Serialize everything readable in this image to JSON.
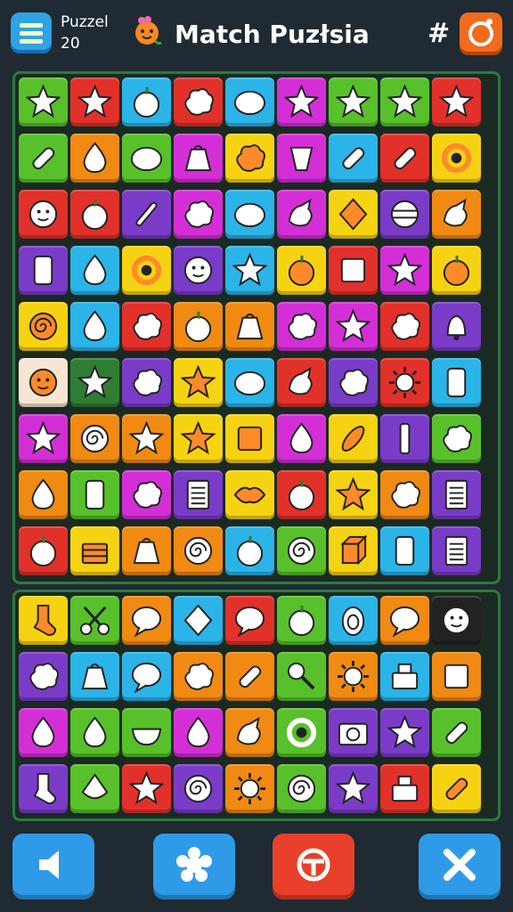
{
  "header": {
    "level_label": "Puzzel",
    "level_number": "20",
    "title": "Match Puzłsia",
    "hash_label": "#",
    "icons": [
      "menu-icon",
      "mascot-icon",
      "settings-icon"
    ]
  },
  "colors": {
    "bg": "#1f2a33",
    "board_border": "#2c7a3e",
    "G": "#58c02a",
    "R": "#e2312a",
    "B": "#2bb4e8",
    "O": "#f08a12",
    "Y": "#f6d312",
    "M": "#d42fd6",
    "P": "#7a3cc8",
    "W": "#f6e6d2",
    "DG": "#2e7d33",
    "DK": "#222222"
  },
  "board_top": {
    "rows": [
      [
        {
          "c": "G",
          "i": "star"
        },
        {
          "c": "R",
          "i": "star"
        },
        {
          "c": "B",
          "i": "apple"
        },
        {
          "c": "R",
          "i": "cloud"
        },
        {
          "c": "B",
          "i": "blob"
        },
        {
          "c": "M",
          "i": "star"
        },
        {
          "c": "G",
          "i": "star"
        },
        {
          "c": "G",
          "i": "star"
        },
        {
          "c": "R",
          "i": "star"
        }
      ],
      [
        {
          "c": "G",
          "i": "pill"
        },
        {
          "c": "O",
          "i": "drop"
        },
        {
          "c": "G",
          "i": "blob"
        },
        {
          "c": "M",
          "i": "bag"
        },
        {
          "c": "Y",
          "i": "cloud"
        },
        {
          "c": "M",
          "i": "cup"
        },
        {
          "c": "B",
          "i": "pill"
        },
        {
          "c": "R",
          "i": "pill"
        },
        {
          "c": "Y",
          "i": "ring"
        }
      ],
      [
        {
          "c": "R",
          "i": "face"
        },
        {
          "c": "R",
          "i": "apple"
        },
        {
          "c": "P",
          "i": "stick"
        },
        {
          "c": "M",
          "i": "cloud"
        },
        {
          "c": "B",
          "i": "blob"
        },
        {
          "c": "M",
          "i": "bird"
        },
        {
          "c": "Y",
          "i": "gem"
        },
        {
          "c": "P",
          "i": "ball"
        },
        {
          "c": "O",
          "i": "bird"
        }
      ],
      [
        {
          "c": "P",
          "i": "phone"
        },
        {
          "c": "B",
          "i": "drop"
        },
        {
          "c": "Y",
          "i": "ring"
        },
        {
          "c": "P",
          "i": "face"
        },
        {
          "c": "B",
          "i": "star"
        },
        {
          "c": "Y",
          "i": "apple"
        },
        {
          "c": "R",
          "i": "box"
        },
        {
          "c": "M",
          "i": "star"
        },
        {
          "c": "Y",
          "i": "apple"
        }
      ],
      [
        {
          "c": "Y",
          "i": "swirl"
        },
        {
          "c": "B",
          "i": "drop"
        },
        {
          "c": "R",
          "i": "cloud"
        },
        {
          "c": "O",
          "i": "apple"
        },
        {
          "c": "O",
          "i": "bag"
        },
        {
          "c": "M",
          "i": "cloud"
        },
        {
          "c": "M",
          "i": "star"
        },
        {
          "c": "R",
          "i": "cloud"
        },
        {
          "c": "P",
          "i": "bell"
        }
      ],
      [
        {
          "c": "W",
          "i": "face"
        },
        {
          "c": "DG",
          "i": "star"
        },
        {
          "c": "P",
          "i": "cloud"
        },
        {
          "c": "Y",
          "i": "star"
        },
        {
          "c": "B",
          "i": "blob"
        },
        {
          "c": "R",
          "i": "bird"
        },
        {
          "c": "P",
          "i": "cloud"
        },
        {
          "c": "R",
          "i": "sun"
        },
        {
          "c": "B",
          "i": "phone"
        }
      ],
      [
        {
          "c": "M",
          "i": "star"
        },
        {
          "c": "O",
          "i": "swirl"
        },
        {
          "c": "O",
          "i": "star"
        },
        {
          "c": "Y",
          "i": "star"
        },
        {
          "c": "Y",
          "i": "box"
        },
        {
          "c": "M",
          "i": "drop"
        },
        {
          "c": "Y",
          "i": "feather"
        },
        {
          "c": "P",
          "i": "bar"
        },
        {
          "c": "G",
          "i": "cloud"
        }
      ],
      [
        {
          "c": "O",
          "i": "drop"
        },
        {
          "c": "G",
          "i": "phone"
        },
        {
          "c": "M",
          "i": "cloud"
        },
        {
          "c": "P",
          "i": "note"
        },
        {
          "c": "Y",
          "i": "lips"
        },
        {
          "c": "R",
          "i": "apple"
        },
        {
          "c": "Y",
          "i": "star"
        },
        {
          "c": "O",
          "i": "cloud"
        },
        {
          "c": "P",
          "i": "note"
        }
      ],
      [
        {
          "c": "R",
          "i": "apple"
        },
        {
          "c": "Y",
          "i": "basket"
        },
        {
          "c": "O",
          "i": "bag"
        },
        {
          "c": "O",
          "i": "swirl"
        },
        {
          "c": "B",
          "i": "apple"
        },
        {
          "c": "G",
          "i": "swirl"
        },
        {
          "c": "Y",
          "i": "cube"
        },
        {
          "c": "B",
          "i": "phone"
        },
        {
          "c": "P",
          "i": "note"
        }
      ]
    ]
  },
  "board_bottom": {
    "rows": [
      [
        {
          "c": "Y",
          "i": "sock"
        },
        {
          "c": "G",
          "i": "scissors"
        },
        {
          "c": "O",
          "i": "bubble"
        },
        {
          "c": "B",
          "i": "gem"
        },
        {
          "c": "R",
          "i": "bubble"
        },
        {
          "c": "G",
          "i": "apple"
        },
        {
          "c": "B",
          "i": "egg"
        },
        {
          "c": "O",
          "i": "bubble"
        },
        {
          "c": "DK",
          "i": "face"
        }
      ],
      [
        {
          "c": "P",
          "i": "cloud"
        },
        {
          "c": "B",
          "i": "bag"
        },
        {
          "c": "B",
          "i": "bubble"
        },
        {
          "c": "O",
          "i": "cloud"
        },
        {
          "c": "O",
          "i": "pill"
        },
        {
          "c": "G",
          "i": "pin"
        },
        {
          "c": "O",
          "i": "sun"
        },
        {
          "c": "B",
          "i": "cake"
        },
        {
          "c": "O",
          "i": "box"
        }
      ],
      [
        {
          "c": "M",
          "i": "drop"
        },
        {
          "c": "G",
          "i": "drop"
        },
        {
          "c": "G",
          "i": "bowl"
        },
        {
          "c": "M",
          "i": "drop"
        },
        {
          "c": "O",
          "i": "bird"
        },
        {
          "c": "G",
          "i": "ring"
        },
        {
          "c": "P",
          "i": "camera"
        },
        {
          "c": "P",
          "i": "star"
        },
        {
          "c": "G",
          "i": "pill"
        }
      ],
      [
        {
          "c": "P",
          "i": "sock"
        },
        {
          "c": "G",
          "i": "top"
        },
        {
          "c": "R",
          "i": "star"
        },
        {
          "c": "P",
          "i": "swirl"
        },
        {
          "c": "O",
          "i": "sun"
        },
        {
          "c": "G",
          "i": "swirl"
        },
        {
          "c": "P",
          "i": "star"
        },
        {
          "c": "R",
          "i": "cake"
        },
        {
          "c": "Y",
          "i": "pill"
        }
      ]
    ]
  },
  "controls": [
    {
      "name": "sound-button",
      "icon": "speaker-icon",
      "color": "#2f9be8"
    },
    {
      "name": "hint-button",
      "icon": "flower-icon",
      "color": "#2f9be8"
    },
    {
      "name": "bomb-button",
      "icon": "target-icon",
      "color": "#e8402a"
    },
    {
      "name": "close-button",
      "icon": "close-icon",
      "color": "#2f9be8"
    }
  ]
}
